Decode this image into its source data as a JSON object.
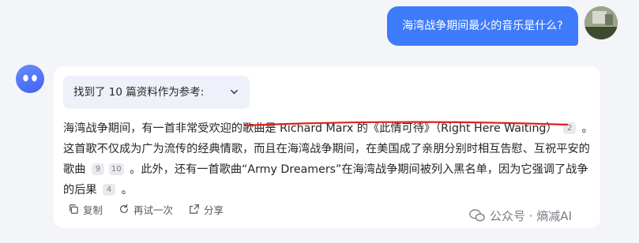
{
  "user": {
    "question": "海湾战争期间最火的音乐是什么?"
  },
  "references": {
    "label": "找到了 10 篇资料作为参考:"
  },
  "answer": {
    "p1_a": "海湾战争期间，有一首非常受欢迎的歌曲是 Richard Marx 的《此情可待》（Right Here Waiting）",
    "cite1": "2",
    "p1_b": "。这首歌不仅成为广为流传的经典情歌，而且在海湾战争期间，在美国成了亲朋分别时相互告慰、互祝平安的歌曲",
    "cite2": "9",
    "cite3": "10",
    "p1_c": "。此外，还有一首歌曲“Army Dreamers”在海湾战争期间被列入黑名单，因为它强调了战争的后果",
    "cite4": "4",
    "p1_d": "。"
  },
  "actions": {
    "copy": "复制",
    "regenerate": "再试一次",
    "share": "分享"
  },
  "watermark": {
    "text": "公众号 · 熵减AI"
  },
  "colors": {
    "accent": "#3e7bfa",
    "underline": "#e02020"
  }
}
